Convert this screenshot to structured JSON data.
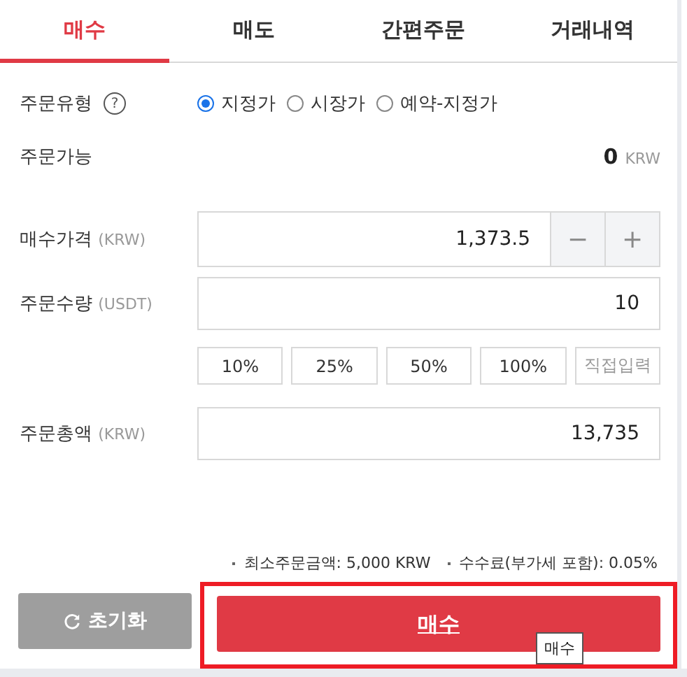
{
  "tabs": [
    {
      "label": "매수",
      "selected": true
    },
    {
      "label": "매도",
      "selected": false
    },
    {
      "label": "간편주문",
      "selected": false
    },
    {
      "label": "거래내역",
      "selected": false
    }
  ],
  "order_type": {
    "label": "주문유형",
    "help_icon": "?",
    "options": [
      {
        "label": "지정가",
        "selected": true
      },
      {
        "label": "시장가",
        "selected": false
      },
      {
        "label": "예약-지정가",
        "selected": false
      }
    ]
  },
  "available": {
    "label": "주문가능",
    "value": "0",
    "unit": "KRW"
  },
  "price": {
    "label": "매수가격",
    "unit": "(KRW)",
    "value": "1,373.5",
    "minus": "−",
    "plus": "+"
  },
  "quantity": {
    "label": "주문수량",
    "unit": "(USDT)",
    "value": "10"
  },
  "percent_buttons": [
    {
      "label": "10%",
      "kind": "preset"
    },
    {
      "label": "25%",
      "kind": "preset"
    },
    {
      "label": "50%",
      "kind": "preset"
    },
    {
      "label": "100%",
      "kind": "preset"
    },
    {
      "label": "직접입력",
      "kind": "manual"
    }
  ],
  "total": {
    "label": "주문총액",
    "unit": "(KRW)",
    "value": "13,735"
  },
  "notes": [
    "최소주문금액: 5,000 KRW",
    "수수료(부가세 포함): 0.05%"
  ],
  "reset_button": "초기화",
  "buy_button": {
    "label": "매수",
    "tooltip": "매수",
    "highlighted": true
  }
}
